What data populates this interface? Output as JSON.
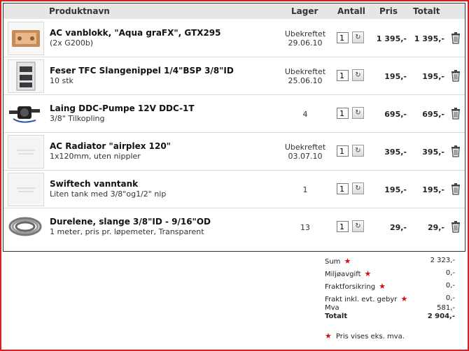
{
  "header": {
    "col_product": "Produktnavn",
    "col_stock": "Lager",
    "col_qty": "Antall",
    "col_price": "Pris",
    "col_total": "Totalt"
  },
  "rows": [
    {
      "name": "AC vanblokk, \"Aqua graFX\", GTX295",
      "desc": "(2x G200b)",
      "stock_line1": "Ubekreftet",
      "stock_line2": "29.06.10",
      "qty": "1",
      "price": "1 395,-",
      "total": "1 395,-",
      "icon": "gpu-waterblock-thumbnail"
    },
    {
      "name": "Feser TFC Slangenippel 1/4\"BSP 3/8\"ID",
      "desc": "10 stk",
      "stock_line1": "Ubekreftet",
      "stock_line2": "25.06.10",
      "qty": "1",
      "price": "195,-",
      "total": "195,-",
      "icon": "fitting-pack-thumbnail"
    },
    {
      "name": "Laing DDC-Pumpe 12V DDC-1T",
      "desc": "3/8\" Tilkopling",
      "stock_line1": "4",
      "stock_line2": "",
      "qty": "1",
      "price": "695,-",
      "total": "695,-",
      "icon": "pump-thumbnail"
    },
    {
      "name": "AC Radiator \"airplex 120\"",
      "desc": "1x120mm, uten nippler",
      "stock_line1": "Ubekreftet",
      "stock_line2": "03.07.10",
      "qty": "1",
      "price": "395,-",
      "total": "395,-",
      "icon": "placeholder-thumbnail"
    },
    {
      "name": "Swiftech vanntank",
      "desc": "Liten tank med 3/8\"og1/2\" nip",
      "stock_line1": "1",
      "stock_line2": "",
      "qty": "1",
      "price": "195,-",
      "total": "195,-",
      "icon": "placeholder-thumbnail"
    },
    {
      "name": "Durelene, slange 3/8\"ID - 9/16\"OD",
      "desc": "1 meter, pris pr. løpemeter, Transparent",
      "stock_line1": "13",
      "stock_line2": "",
      "qty": "1",
      "price": "29,-",
      "total": "29,-",
      "icon": "tubing-coil-thumbnail"
    }
  ],
  "summary": {
    "sum_label": "Sum",
    "sum_value": "2 323,-",
    "env_label": "Miljøavgift",
    "env_value": "0,-",
    "insurance_label": "Fraktforsikring",
    "insurance_value": "0,-",
    "freight_label": "Frakt inkl. evt. gebyr",
    "freight_value": "0,-",
    "vat_label": "Mva",
    "vat_value": "581,-",
    "total_label": "Totalt",
    "total_value": "2 904,-",
    "note": "Pris vises eks. mva.",
    "star_glyph": "★"
  },
  "colors": {
    "border": "#d42020",
    "star": "#cc1111",
    "header_bg": "#e6e6e6"
  }
}
